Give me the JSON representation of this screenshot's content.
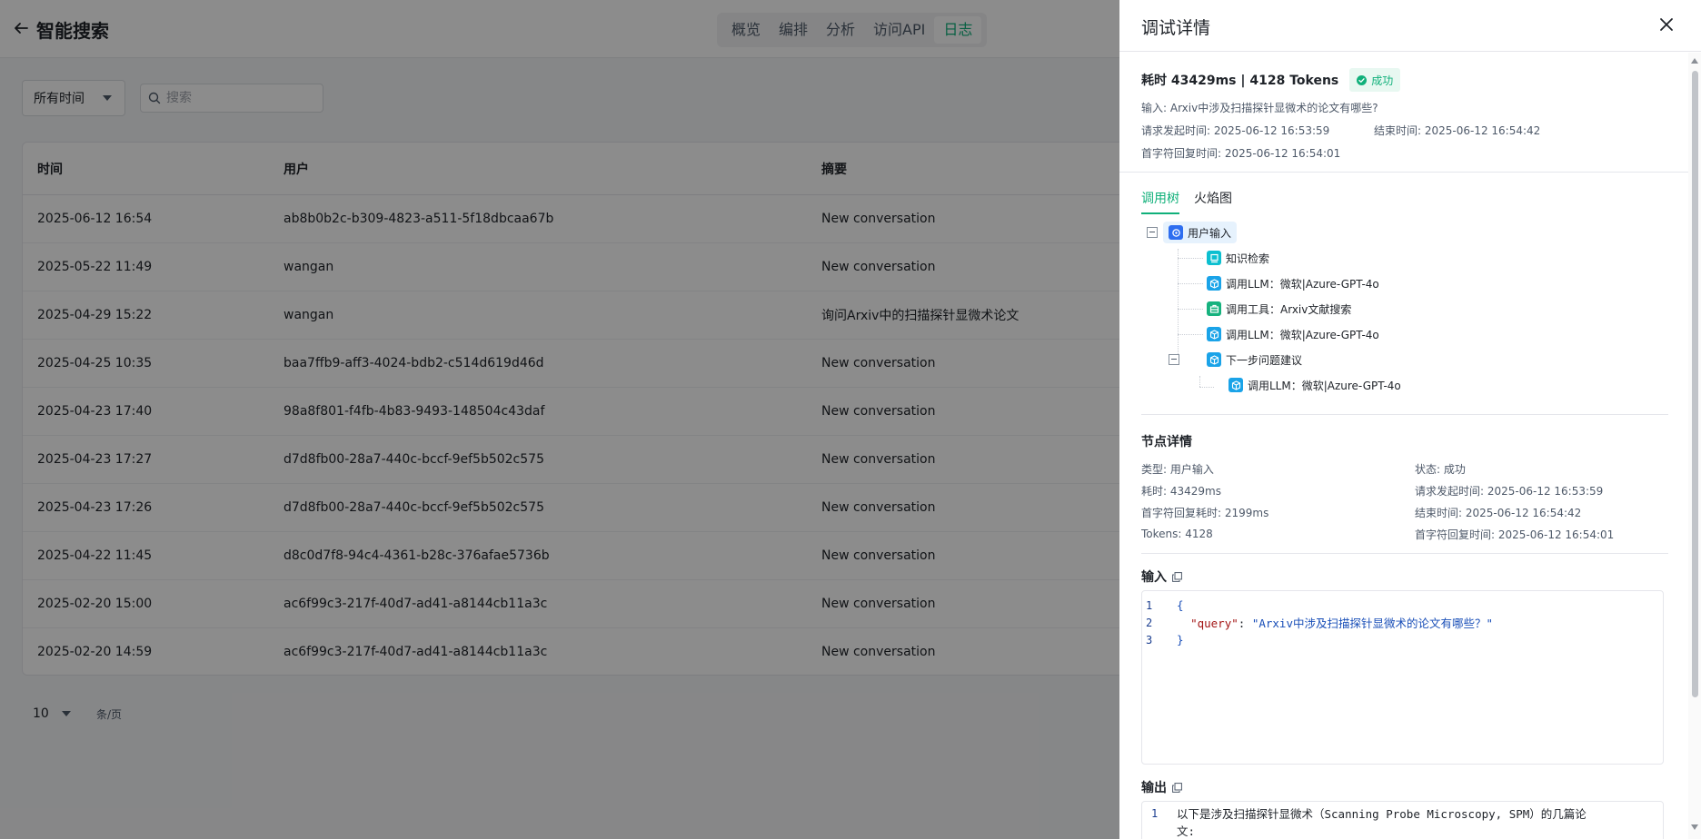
{
  "header": {
    "title": "智能搜索",
    "tabs": [
      "概览",
      "编排",
      "分析",
      "访问API",
      "日志"
    ],
    "active_tab": "日志"
  },
  "filters": {
    "time_range": "所有时间",
    "search_placeholder": "搜索"
  },
  "table": {
    "columns": [
      "时间",
      "用户",
      "摘要"
    ],
    "rows": [
      {
        "time": "2025-06-12 16:54",
        "user": "ab8b0b2c-b309-4823-a511-5f18dbcaa67b",
        "summary": "New conversation"
      },
      {
        "time": "2025-05-22 11:49",
        "user": "wangan",
        "summary": "New conversation"
      },
      {
        "time": "2025-04-29 15:22",
        "user": "wangan",
        "summary": "询问Arxiv中的扫描探针显微术论文"
      },
      {
        "time": "2025-04-25 10:35",
        "user": "baa7ffb9-aff3-4024-bdb2-c514d619d46d",
        "summary": "New conversation"
      },
      {
        "time": "2025-04-23 17:40",
        "user": "98a8f801-f4fb-4b83-9493-148504c43daf",
        "summary": "New conversation"
      },
      {
        "time": "2025-04-23 17:27",
        "user": "d7d8fb00-28a7-440c-bccf-9ef5b502c575",
        "summary": "New conversation"
      },
      {
        "time": "2025-04-23 17:26",
        "user": "d7d8fb00-28a7-440c-bccf-9ef5b502c575",
        "summary": "New conversation"
      },
      {
        "time": "2025-04-22 11:45",
        "user": "d8c0d7f8-94c4-4361-b28c-376afae5736b",
        "summary": "New conversation"
      },
      {
        "time": "2025-02-20 15:00",
        "user": "ac6f99c3-217f-40d7-ad41-a8144cb11a3c",
        "summary": "New conversation"
      },
      {
        "time": "2025-02-20 14:59",
        "user": "ac6f99c3-217f-40d7-ad41-a8144cb11a3c",
        "summary": "New conversation"
      }
    ]
  },
  "pagination": {
    "page_size": "10",
    "unit": "条/页"
  },
  "drawer": {
    "title": "调试详情",
    "summary": {
      "cost_line": "耗时  43429ms   | 4128 Tokens",
      "status": "成功",
      "input": "输入: Arxiv中涉及扫描探针显微术的论文有哪些?",
      "request_time": "请求发起时间: 2025-06-12 16:53:59",
      "end_time": "结束时间: 2025-06-12 16:54:42",
      "first_reply_time": "首字符回复时间: 2025-06-12 16:54:01"
    },
    "view_tabs": [
      "调用树",
      "火焰图"
    ],
    "active_view_tab": "调用树",
    "tree": [
      {
        "label": "用户输入",
        "icon": "user-input-icon",
        "color": "#2e6ef0",
        "depth": 0
      },
      {
        "label": "知识检索",
        "icon": "knowledge-retrieval-icon",
        "color": "#0cbfd0",
        "depth": 1
      },
      {
        "label": "调用LLM：微软|Azure-GPT-4o",
        "icon": "llm-cube-icon",
        "color": "#1aa3e8",
        "depth": 1
      },
      {
        "label": "调用工具：Arxiv文献搜索",
        "icon": "tool-icon",
        "color": "#16b27e",
        "depth": 1
      },
      {
        "label": "调用LLM：微软|Azure-GPT-4o",
        "icon": "llm-cube-icon",
        "color": "#1aa3e8",
        "depth": 1
      },
      {
        "label": "下一步问题建议",
        "icon": "llm-cube-icon",
        "color": "#1aa3e8",
        "depth": 1
      },
      {
        "label": "调用LLM：微软|Azure-GPT-4o",
        "icon": "llm-cube-icon",
        "color": "#1aa3e8",
        "depth": 2
      }
    ],
    "node_detail": {
      "title": "节点详情",
      "rows": [
        [
          "类型: 用户输入",
          "状态: 成功"
        ],
        [
          "耗时: 43429ms",
          "请求发起时间: 2025-06-12 16:53:59"
        ],
        [
          "首字符回复耗时: 2199ms",
          "结束时间: 2025-06-12 16:54:42"
        ],
        [
          "Tokens: 4128",
          "首字符回复时间: 2025-06-12 16:54:01"
        ]
      ]
    },
    "input_label": "输入",
    "input_code": {
      "open": "{",
      "key": "\"query\"",
      "colon": ": ",
      "value": "\"Arxiv中涉及扫描探针显微术的论文有哪些？\"",
      "close": "}"
    },
    "output_label": "输出",
    "output_code": {
      "line1": "以下是涉及扫描探针显微术（Scanning Probe Microscopy, SPM）的几篇论",
      "line1_cont": "文:"
    }
  },
  "colors": {
    "accent": "#10b07a",
    "mask": "rgba(0,0,0,0.45)"
  }
}
